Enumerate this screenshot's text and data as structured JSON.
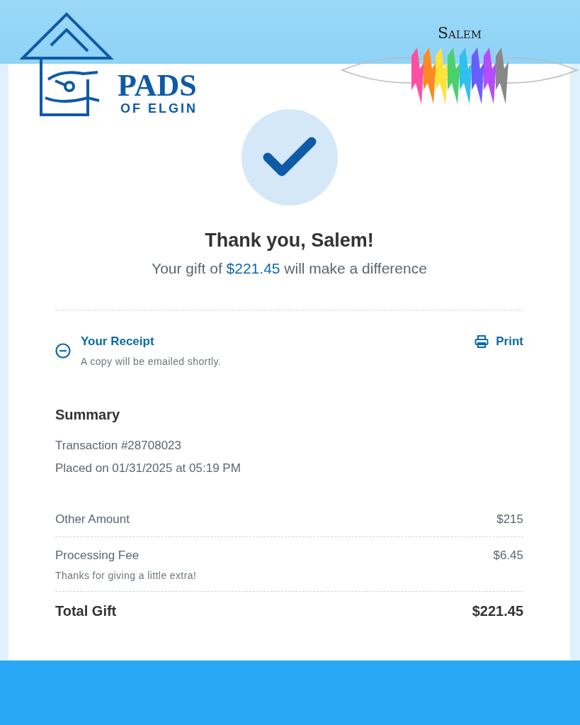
{
  "header": {
    "organization_logo": {
      "name": "PADS",
      "subtitle": "OF ELGIN"
    },
    "donor_logo": {
      "name": "Salem"
    }
  },
  "confirmation": {
    "title": "Thank you, Salem!",
    "message_before": "Your gift of",
    "amount": "$221.45",
    "message_after": "will make a difference"
  },
  "receipt": {
    "title": "Your Receipt",
    "note": "A copy will be emailed shortly.",
    "expanded": true,
    "print_label": "Print"
  },
  "summary": {
    "title": "Summary",
    "transaction": "Transaction #28708023",
    "placed": "Placed on 01/31/2025 at 05:19 PM",
    "lines": [
      {
        "label": "Other Amount",
        "amount": "$215"
      },
      {
        "label": "Processing Fee",
        "amount": "$6.45",
        "note": "Thanks for giving a little extra!"
      }
    ],
    "total": {
      "label": "Total Gift",
      "amount": "$221.45"
    }
  }
}
